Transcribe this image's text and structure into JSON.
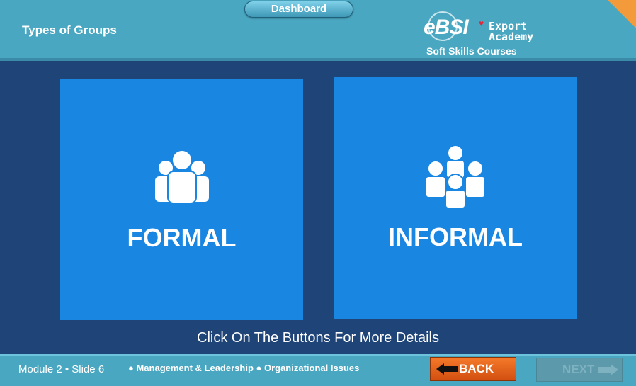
{
  "header": {
    "title": "Types of Groups",
    "dashboard_label": "Dashboard",
    "logo": {
      "brand": "eBSI",
      "line1": "Export",
      "line2": "Academy",
      "subtitle": "Soft Skills Courses"
    }
  },
  "cards": {
    "formal_label": "FORMAL",
    "informal_label": "INFORMAL",
    "formal_icon": "group-icon",
    "informal_icon": "people-network-icon"
  },
  "instruction": "Click On The Buttons For More Details",
  "footer": {
    "slide_info": "Module 2 • Slide 6",
    "breadcrumb": "● Management & Leadership  ● Organizational Issues",
    "back_label": "BACK",
    "next_label": "NEXT"
  },
  "colors": {
    "background": "#1f4477",
    "header": "#4aa7c1",
    "card": "#1986e2",
    "back_button": "#e0601c",
    "accent_corner": "#f39a3a"
  }
}
